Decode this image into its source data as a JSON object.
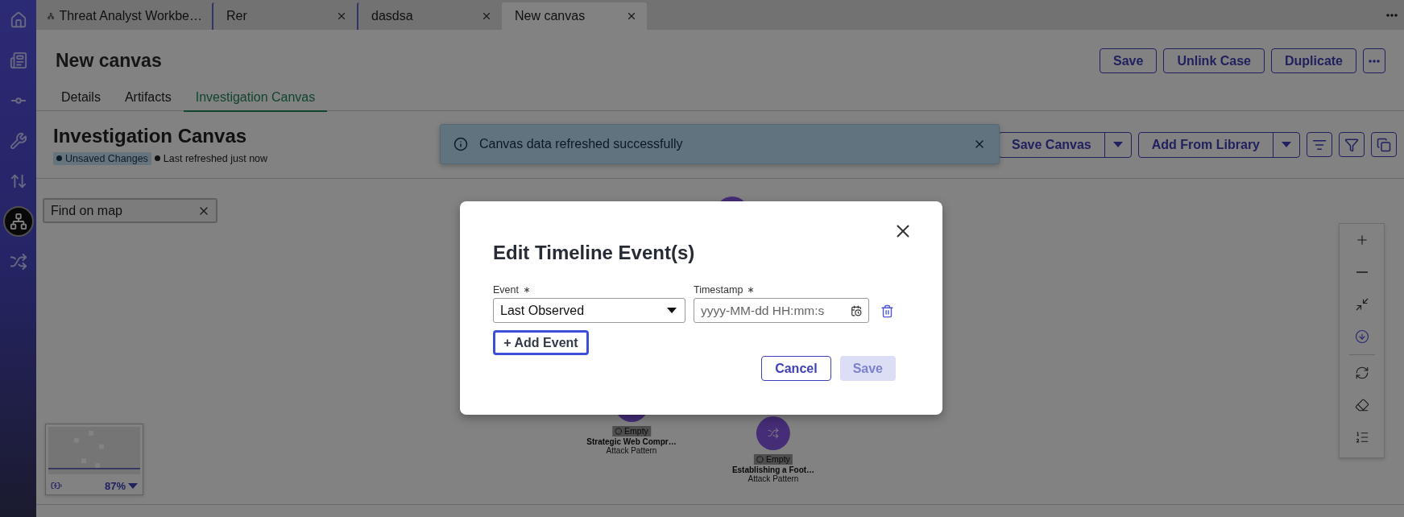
{
  "sidebar": {
    "items": [
      {
        "kind": "home",
        "selected": false
      },
      {
        "kind": "reports",
        "selected": false
      },
      {
        "kind": "link",
        "selected": false
      },
      {
        "kind": "tools",
        "selected": false
      },
      {
        "kind": "transfer",
        "selected": false
      },
      {
        "kind": "hierarchy",
        "selected": true
      },
      {
        "kind": "shuffle",
        "selected": false
      }
    ]
  },
  "tabs": [
    {
      "label": "Threat Analyst Workbe…",
      "selected": false,
      "closable": false
    },
    {
      "label": "Rer",
      "selected": false,
      "closable": true
    },
    {
      "label": "dasdsa",
      "selected": false,
      "closable": true
    },
    {
      "label": "New canvas",
      "selected": true,
      "closable": true
    }
  ],
  "page": {
    "title": "New canvas",
    "actions": [
      "Save",
      "Unlink Case",
      "Duplicate"
    ]
  },
  "subtabs": [
    {
      "label": "Details",
      "selected": false
    },
    {
      "label": "Artifacts",
      "selected": false
    },
    {
      "label": "Investigation Canvas",
      "selected": true
    }
  ],
  "canvas_header": {
    "title": "Investigation Canvas",
    "badge": "Unsaved Changes",
    "status": "Last refreshed just now",
    "split_buttons": [
      "Save Canvas",
      "Add From Library"
    ]
  },
  "toast": {
    "message": "Canvas data refreshed successfully"
  },
  "search": {
    "placeholder": "Find on map"
  },
  "nodes": [
    {
      "status": "Empty",
      "title": "Strategic Web Compr…",
      "type": "Attack Pattern"
    },
    {
      "status": "Empty",
      "title": "Establishing a Foot…",
      "type": "Attack Pattern"
    }
  ],
  "minimap": {
    "zoom": "87%"
  },
  "canvas_tools": [
    {
      "kind": "zoom-in",
      "selected": false
    },
    {
      "kind": "zoom-out",
      "selected": false
    },
    {
      "kind": "fit",
      "selected": false
    },
    {
      "kind": "download",
      "selected": true
    },
    {
      "kind": "refresh",
      "selected": false
    },
    {
      "kind": "erase",
      "selected": false
    },
    {
      "kind": "legend",
      "selected": false
    }
  ],
  "dialog": {
    "title": "Edit Timeline Event(s)",
    "events": [
      {
        "event_label": "Event",
        "event_required": true,
        "event_value": "Last Observed",
        "timestamp_label": "Timestamp",
        "timestamp_required": true,
        "timestamp_placeholder": "yyyy-MM-dd HH:mm:s"
      }
    ],
    "add_button": "+ Add Event",
    "cancel": "Cancel",
    "save": {
      "label": "Save",
      "disabled": true
    }
  }
}
